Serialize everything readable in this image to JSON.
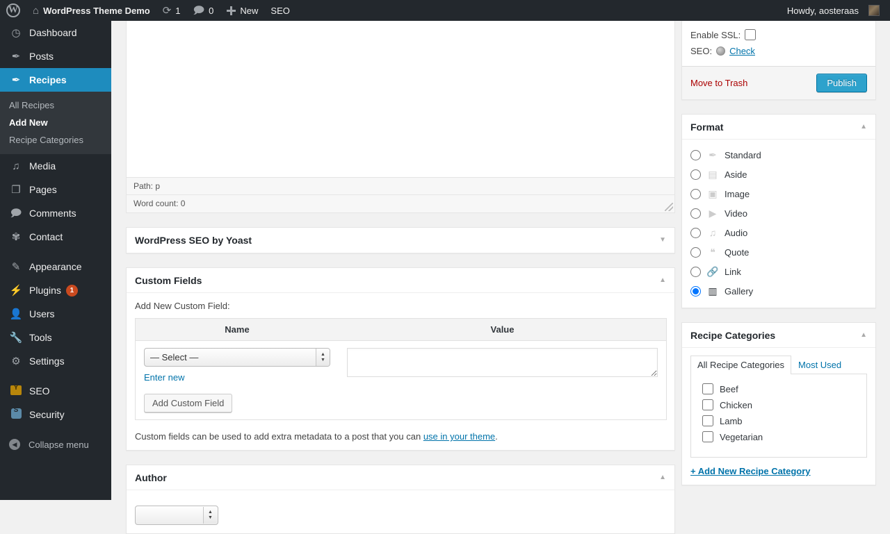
{
  "adminbar": {
    "logo_icon": "wordpress-logo-icon",
    "home_icon": "home-icon",
    "site_name": "WordPress Theme Demo",
    "updates_icon": "updates-icon",
    "updates_count": "1",
    "comments_icon": "comment-bubble-icon",
    "comments_count": "0",
    "new_icon": "plus-icon",
    "new_label": "New",
    "seo_label": "SEO",
    "howdy": "Howdy, aosteraas",
    "avatar": "user-avatar"
  },
  "sidebar": {
    "items": [
      {
        "label": "Dashboard",
        "icon": "dashboard-icon",
        "glyph": "◉"
      },
      {
        "label": "Posts",
        "icon": "pin-icon",
        "glyph": "📌"
      },
      {
        "label": "Recipes",
        "icon": "pin-icon",
        "glyph": "📌"
      },
      {
        "label": "Media",
        "icon": "media-icon",
        "glyph": "🎵"
      },
      {
        "label": "Pages",
        "icon": "pages-icon",
        "glyph": "📄"
      },
      {
        "label": "Comments",
        "icon": "comment-bubble-icon",
        "glyph": "💬"
      },
      {
        "label": "Contact",
        "icon": "gear-icon",
        "glyph": "✿"
      },
      {
        "label": "Appearance",
        "icon": "paintbrush-icon",
        "glyph": "🖌"
      },
      {
        "label": "Plugins",
        "icon": "plug-icon",
        "glyph": "🔌",
        "badge": "1"
      },
      {
        "label": "Users",
        "icon": "user-icon",
        "glyph": "👤"
      },
      {
        "label": "Tools",
        "icon": "wrench-icon",
        "glyph": "🔧"
      },
      {
        "label": "Settings",
        "icon": "sliders-icon",
        "glyph": "⚙"
      },
      {
        "label": "SEO",
        "icon": "yoast-seo-icon",
        "glyph": ""
      },
      {
        "label": "Security",
        "icon": "security-shield-icon",
        "glyph": ""
      }
    ],
    "submenu": [
      {
        "label": "All Recipes",
        "current": false
      },
      {
        "label": "Add New",
        "current": true
      },
      {
        "label": "Recipe Categories",
        "current": false
      }
    ],
    "collapse_label": "Collapse menu",
    "collapse_icon": "collapse-arrow-icon"
  },
  "editor": {
    "path_status": "Path: p",
    "word_count": "Word count: 0",
    "resize_handle": "resize-grip-icon"
  },
  "boxes": {
    "yoast": {
      "title": "WordPress SEO by Yoast",
      "toggle_icon": "chevron-down-icon"
    },
    "custom_fields": {
      "title": "Custom Fields",
      "toggle_icon": "chevron-up-icon",
      "add_label": "Add New Custom Field:",
      "columns": [
        "Name",
        "Value"
      ],
      "select_value": "— Select —",
      "select_options": [
        "— Select —"
      ],
      "value_text": "",
      "enter_new_label": "Enter new",
      "add_button_label": "Add Custom Field",
      "help_text_before": "Custom fields can be used to add extra metadata to a post that you can ",
      "help_link": "use in your theme",
      "help_text_after": "."
    },
    "author": {
      "title": "Author",
      "toggle_icon": "chevron-up-icon"
    }
  },
  "publish": {
    "enable_ssl_label": "Enable SSL:",
    "enable_ssl_checked": false,
    "seo_label": "SEO:",
    "seo_status_icon": "seo-status-dot",
    "seo_check_link": "Check",
    "trash_label": "Move to Trash",
    "publish_label": "Publish"
  },
  "format": {
    "title": "Format",
    "toggle_icon": "chevron-up-icon",
    "options": [
      {
        "label": "Standard",
        "icon": "pin-icon",
        "glyph": "📌",
        "selected": false
      },
      {
        "label": "Aside",
        "icon": "aside-icon",
        "glyph": "▤",
        "selected": false
      },
      {
        "label": "Image",
        "icon": "image-icon",
        "glyph": "▣",
        "selected": false
      },
      {
        "label": "Video",
        "icon": "video-icon",
        "glyph": "▶",
        "selected": false
      },
      {
        "label": "Audio",
        "icon": "audio-icon",
        "glyph": "♫",
        "selected": false
      },
      {
        "label": "Quote",
        "icon": "quote-icon",
        "glyph": "❝",
        "selected": false
      },
      {
        "label": "Link",
        "icon": "link-icon",
        "glyph": "🔗",
        "selected": false
      },
      {
        "label": "Gallery",
        "icon": "gallery-icon",
        "glyph": "▥",
        "selected": true
      }
    ]
  },
  "recipe_categories": {
    "title": "Recipe Categories",
    "toggle_icon": "chevron-up-icon",
    "tabs": [
      {
        "label": "All Recipe Categories",
        "active": true
      },
      {
        "label": "Most Used",
        "active": false
      }
    ],
    "items": [
      {
        "label": "Beef",
        "checked": false
      },
      {
        "label": "Chicken",
        "checked": false
      },
      {
        "label": "Lamb",
        "checked": false
      },
      {
        "label": "Vegetarian",
        "checked": false
      }
    ],
    "add_link": "+ Add New Recipe Category"
  },
  "colors": {
    "admin_bar_bg": "#23282d",
    "menu_current": "#1e8cbe",
    "accent_blue": "#0073aa",
    "publish_button": "#2ea2cc",
    "badge_red": "#ca4a1f",
    "trash_red": "#a00"
  }
}
